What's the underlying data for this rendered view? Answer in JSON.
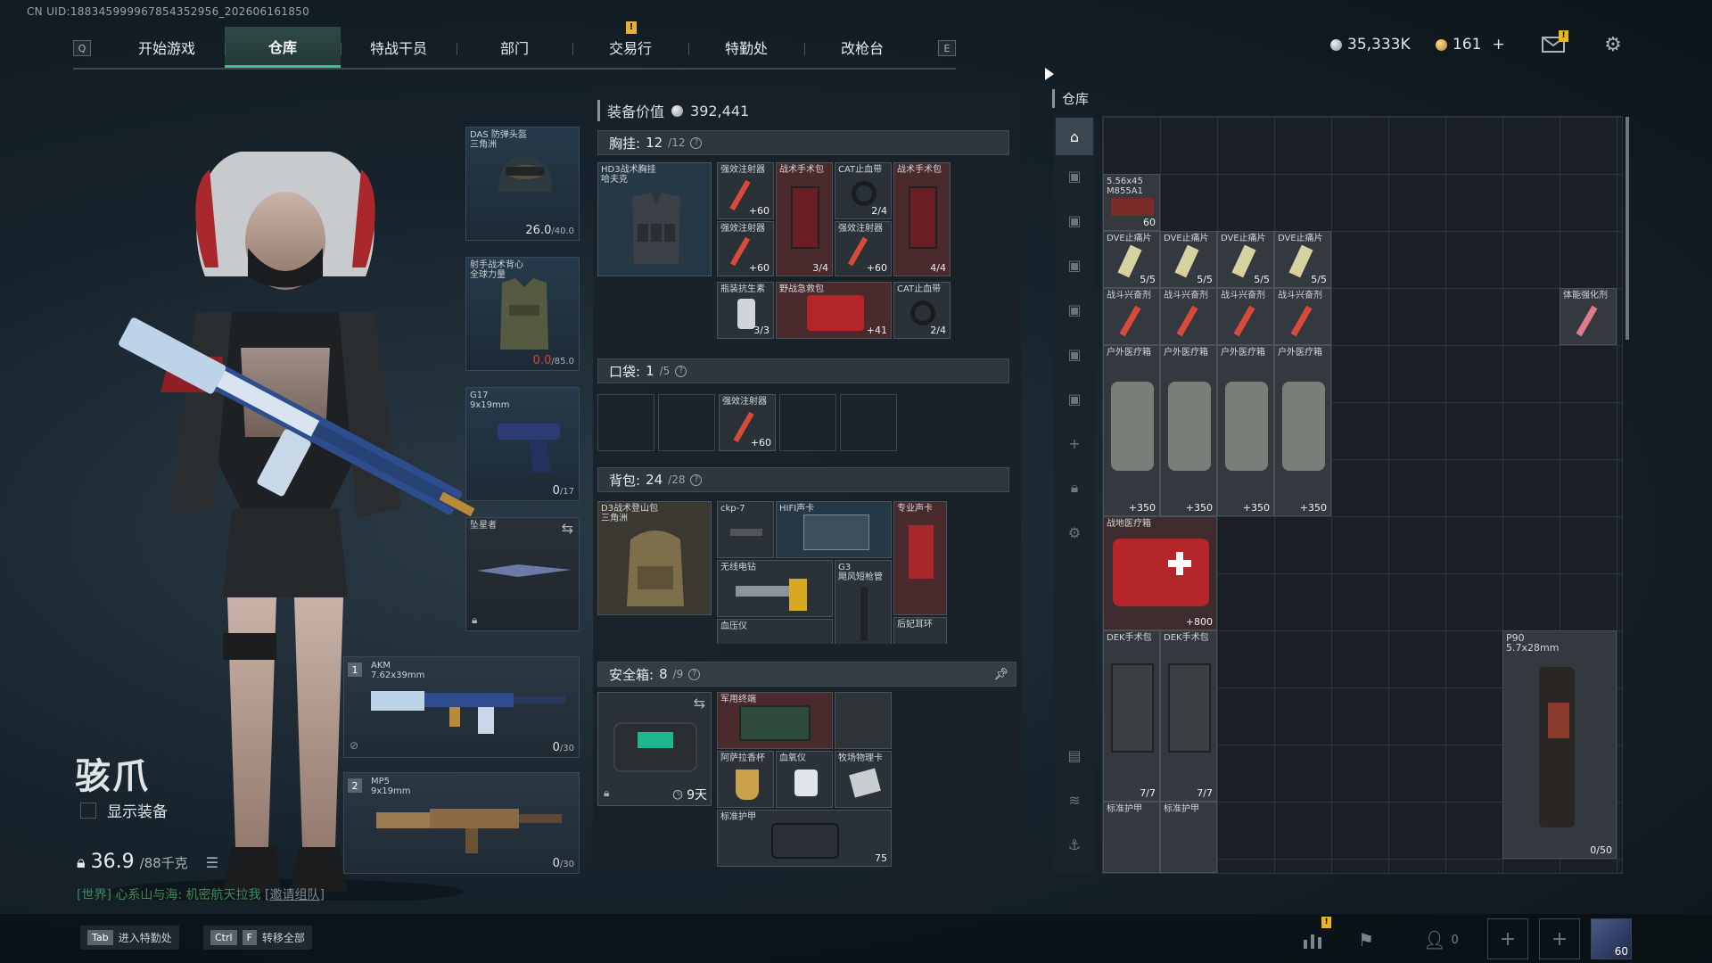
{
  "uid": "CN UID:188345999967854352956_202606161850",
  "nav": {
    "left_key": "Q",
    "right_key": "E",
    "tabs": [
      {
        "label": "开始游戏"
      },
      {
        "label": "仓库",
        "active": true
      },
      {
        "label": "特战干员"
      },
      {
        "label": "部门"
      },
      {
        "label": "交易行",
        "warning": "!"
      },
      {
        "label": "特勤处"
      },
      {
        "label": "改枪台"
      }
    ]
  },
  "currency": {
    "silver": "35,333K",
    "gold": "161",
    "add": "+"
  },
  "mail_warning": "!",
  "character": {
    "name": "骇爪",
    "show_equipment": "显示装备",
    "weight_current": "36.9",
    "weight_max": "/88千克"
  },
  "chat": {
    "channel": "[世界]",
    "text": " 心系山与海: 机密航天拉我 ",
    "link": "[邀请组队]"
  },
  "equipment": {
    "helmet": {
      "label": "DAS 防弹头盔\n三角洲",
      "value": "26.0",
      "max": "/40.0"
    },
    "armor": {
      "label": "射手战术背心\n全球力量",
      "value": "0.0",
      "max": "/85.0"
    },
    "pistol": {
      "label": "G17\n9x19mm",
      "value": "0",
      "max": "/17"
    },
    "melee": {
      "label": "坠星者"
    },
    "primary": {
      "num": "1",
      "name": "AKM",
      "caliber": "7.62x39mm",
      "value": "0",
      "max": "/30"
    },
    "secondary": {
      "num": "2",
      "name": "MP5",
      "caliber": "9x19mm",
      "value": "0",
      "max": "/30"
    }
  },
  "middle": {
    "value_label": "装备价值",
    "value": "392,441",
    "chest": {
      "title": "胸挂:",
      "count": "12",
      "cap": "/12",
      "rig": "HD3战术胸挂\n哈夫克",
      "items": [
        {
          "label": "强效注射器",
          "val": "+60"
        },
        {
          "label": "战术手术包",
          "val": "3/4"
        },
        {
          "label": "CAT止血带",
          "val": "2/4"
        },
        {
          "label": "战术手术包",
          "val": "4/4"
        },
        {
          "label": "强效注射器",
          "val": "+60"
        },
        {
          "label": "强效注射器",
          "val": "+60"
        },
        {
          "label": "瓶装抗生素",
          "val": "3/3"
        },
        {
          "label": "野战急救包",
          "val": "+41"
        },
        {
          "label": "CAT止血带",
          "val": "2/4"
        }
      ]
    },
    "pocket": {
      "title": "口袋:",
      "count": "1",
      "cap": "/5",
      "item": {
        "label": "强效注射器",
        "val": "+60"
      }
    },
    "backpack": {
      "title": "背包:",
      "count": "24",
      "cap": "/28",
      "bag": "D3战术登山包\n三角洲",
      "items": [
        {
          "label": "ckp-7"
        },
        {
          "label": "HIFI声卡"
        },
        {
          "label": "专业声卡"
        },
        {
          "label": "无线电钻"
        },
        {
          "label": "G3\n飓风短枪管"
        },
        {
          "label": "血压仪"
        },
        {
          "label": "后妃耳环"
        }
      ]
    },
    "safebox": {
      "title": "安全箱:",
      "count": "8",
      "cap": "/9",
      "timer": "9天",
      "items": [
        {
          "label": "军用终端"
        },
        {
          "label": "阿萨拉香杯"
        },
        {
          "label": "血氧仪"
        },
        {
          "label": "牧场物理卡"
        },
        {
          "label": "标准护甲",
          "val": "75"
        }
      ]
    }
  },
  "stash": {
    "title": "仓库",
    "items": [
      {
        "label": "5.56x45\nM855A1",
        "val": "60"
      },
      {
        "label": "DVE止痛片",
        "val": "5/5"
      },
      {
        "label": "DVE止痛片",
        "val": "5/5"
      },
      {
        "label": "DVE止痛片",
        "val": "5/5"
      },
      {
        "label": "DVE止痛片",
        "val": "5/5"
      },
      {
        "label": "战斗兴奋剂"
      },
      {
        "label": "战斗兴奋剂"
      },
      {
        "label": "战斗兴奋剂"
      },
      {
        "label": "战斗兴奋剂"
      },
      {
        "label": "体能强化剂"
      },
      {
        "label": "户外医疗箱",
        "val": "+350"
      },
      {
        "label": "户外医疗箱",
        "val": "+350"
      },
      {
        "label": "户外医疗箱",
        "val": "+350"
      },
      {
        "label": "户外医疗箱",
        "val": "+350"
      },
      {
        "label": "战地医疗箱",
        "val": "+800"
      },
      {
        "label": "DEK手术包",
        "val": "7/7"
      },
      {
        "label": "DEK手术包",
        "val": "7/7"
      },
      {
        "label": "P90\n5.7x28mm",
        "val": "0/50"
      },
      {
        "label": "标准护甲"
      },
      {
        "label": "标准护甲"
      }
    ]
  },
  "bottom": {
    "hint1_key": "Tab",
    "hint1": "进入特勤处",
    "hint2_key1": "Ctrl",
    "hint2_key2": "F",
    "hint2": "转移全部",
    "team_count": "0",
    "avatar_level": "60",
    "stats_warning": "!"
  },
  "colors": {
    "accent_green": "#33c48c",
    "warning_yellow": "#e8b32a",
    "armor_red": "#e0452f"
  }
}
